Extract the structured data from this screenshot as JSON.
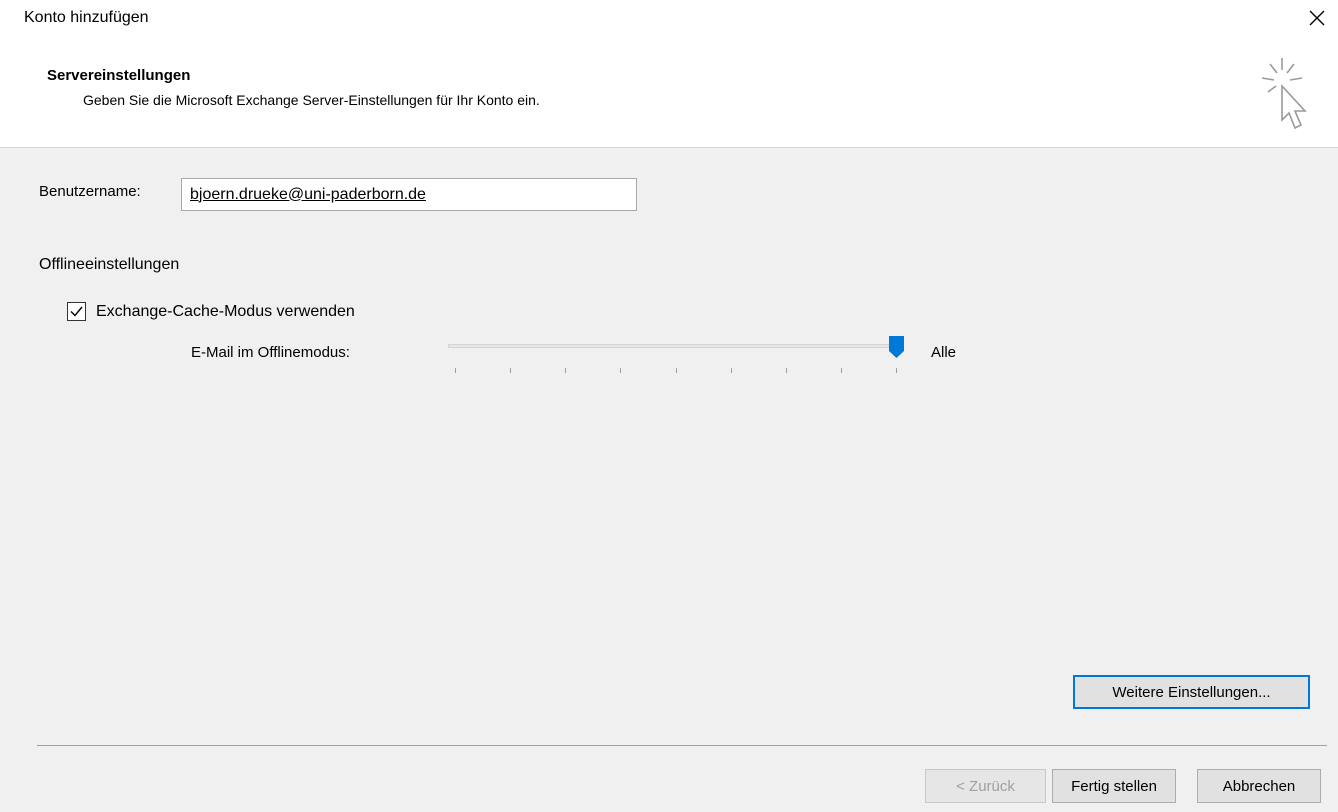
{
  "window": {
    "title": "Konto hinzufügen",
    "close_icon": "close-icon"
  },
  "header": {
    "heading": "Servereinstellungen",
    "description": "Geben Sie die Microsoft Exchange Server-Einstellungen für Ihr Konto ein.",
    "icon": "wizard-cursor-icon"
  },
  "form": {
    "username_label": "Benutzername:",
    "username_value": "bjoern.drueke@uni-paderborn.de",
    "offline_section_label": "Offlineeinstellungen",
    "cache_mode_label": "Exchange-Cache-Modus verwenden",
    "cache_mode_checked": true,
    "offline_mail_label": "E-Mail im Offlinemodus:",
    "offline_mail_value_label": "Alle",
    "offline_mail_slider_fraction": 1.0,
    "more_settings_label": "Weitere Einstellungen..."
  },
  "footer": {
    "back_label": "< Zurück",
    "finish_label": "Fertig stellen",
    "cancel_label": "Abbrechen"
  },
  "colors": {
    "accent": "#0078d7",
    "background": "#f0f0f0"
  }
}
